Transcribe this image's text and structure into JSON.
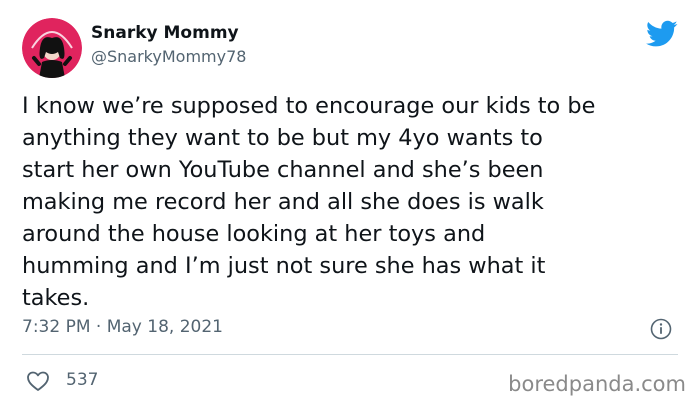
{
  "author": {
    "display_name": "Snarky Mommy",
    "handle": "@SnarkyMommy78",
    "avatar_icon": "snarky-mommy-avatar",
    "avatar_bg": "#e0245e"
  },
  "tweet": {
    "text": "I know we’re supposed to encourage our kids to be\nanything they want to be but my 4yo wants to\nstart her own YouTube channel and she’s been\nmaking me record her and all she does is walk\naround the house looking at her toys and\nhumming and I’m just not sure she has what it\ntakes.",
    "timestamp": "7:32 PM · May 18, 2021",
    "likes": "537"
  },
  "icons": {
    "brand": "twitter-bird-icon",
    "info": "info-icon",
    "like": "heart-icon"
  },
  "colors": {
    "twitter_blue": "#1d9bf0",
    "secondary_text": "#536471",
    "primary_text": "#0f1419"
  },
  "watermark": "boredpanda.com"
}
